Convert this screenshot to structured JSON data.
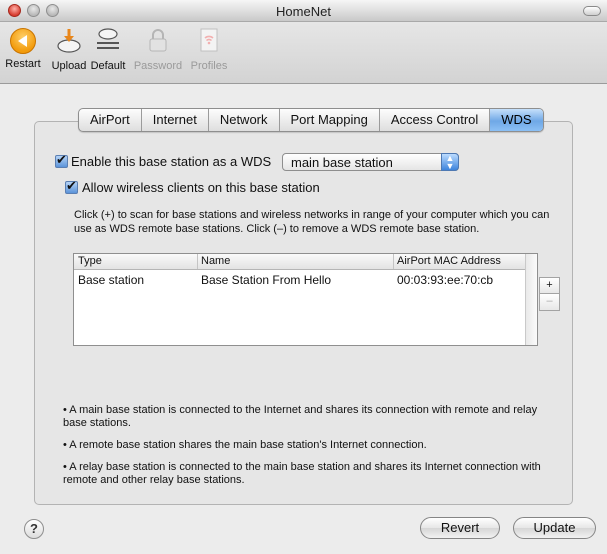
{
  "window": {
    "title": "HomeNet"
  },
  "toolbar": {
    "restart": "Restart",
    "upload": "Upload",
    "default": "Default",
    "password": "Password",
    "profiles": "Profiles"
  },
  "tabs": [
    "AirPort",
    "Internet",
    "Network",
    "Port Mapping",
    "Access Control",
    "WDS"
  ],
  "active_tab": "WDS",
  "wds": {
    "enable_label": "Enable this base station as a WDS",
    "enable_checked": true,
    "mode_value": "main base station",
    "allow_clients_label": "Allow wireless clients on this base station",
    "allow_clients_checked": true,
    "instructions": "Click (+) to scan for base stations and wireless networks in range of your computer which you can use as WDS remote base stations. Click (–) to remove a WDS remote base station."
  },
  "table": {
    "columns": [
      "Type",
      "Name",
      "AirPort MAC Address"
    ],
    "rows": [
      [
        "Base station",
        "Base Station From Hello",
        "00:03:93:ee:70:cb"
      ]
    ]
  },
  "buttons": {
    "add": "+",
    "remove": "–",
    "help": "?",
    "revert": "Revert",
    "update": "Update"
  },
  "notes": [
    "• A main base station is connected to the Internet and shares its connection with remote and relay base stations.",
    "• A remote base station shares the main base station's Internet connection.",
    "• A relay base station is connected to the main base station and shares its Internet connection with remote and other relay base stations."
  ]
}
